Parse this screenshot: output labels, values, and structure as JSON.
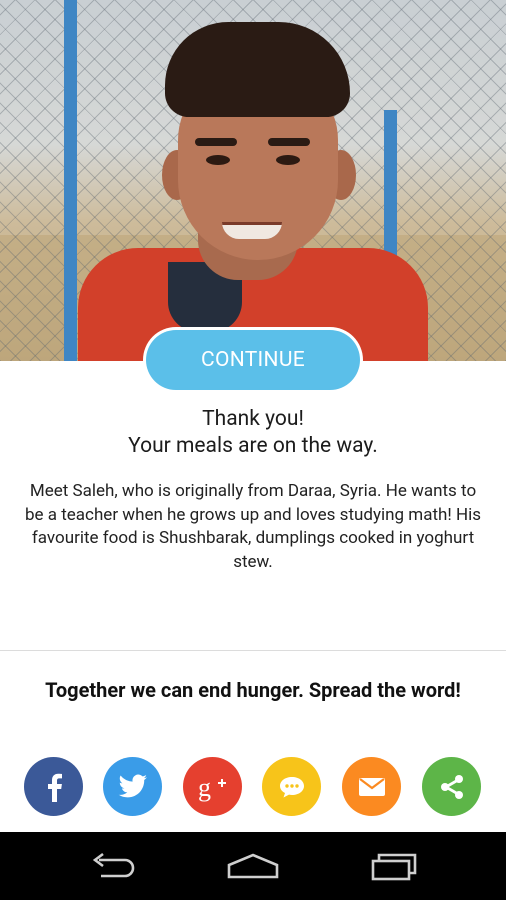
{
  "hero": {
    "continue_label": "CONTINUE"
  },
  "thanks": {
    "line1": "Thank you!",
    "line2": "Your meals are on the way."
  },
  "story": "Meet Saleh, who is originally from Daraa, Syria. He wants to be a teacher when he grows up and loves studying math! His favourite food is Shushbarak, dumplings cooked in yoghurt stew.",
  "spread": {
    "text": "Together we can end hunger. Spread the word!"
  },
  "share": [
    {
      "name": "facebook",
      "icon": "facebook-icon",
      "color": "#3b5998"
    },
    {
      "name": "twitter",
      "icon": "twitter-icon",
      "color": "#3a9ce8"
    },
    {
      "name": "google-plus",
      "icon": "google-plus-icon",
      "color": "#e5402f"
    },
    {
      "name": "message",
      "icon": "chat-bubble-icon",
      "color": "#f7c41a"
    },
    {
      "name": "email",
      "icon": "envelope-icon",
      "color": "#fb8a21"
    },
    {
      "name": "share",
      "icon": "share-icon",
      "color": "#5db548"
    }
  ],
  "colors": {
    "accent": "#5bbfe9",
    "text": "#222222"
  }
}
